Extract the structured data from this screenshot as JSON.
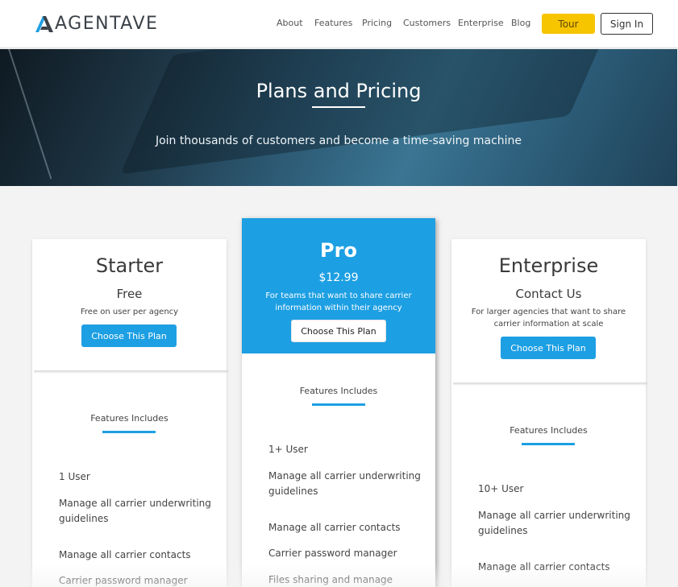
{
  "header": {
    "logo_text": "AGENTAVE",
    "nav": [
      "About",
      "Features",
      "Pricing",
      "Customers",
      "Enterprise",
      "Blog"
    ],
    "tour_label": "Tour",
    "signin_label": "Sign In"
  },
  "hero": {
    "title": "Plans and Pricing",
    "subtitle": "Join thousands of customers and become a time-saving machine"
  },
  "plans": [
    {
      "name": "Starter",
      "price": "Free",
      "description": "Free on user per agency",
      "button": "Choose This Plan",
      "features_heading": "Features Includes",
      "features": [
        "1 User",
        "Manage all carrier underwriting guidelines",
        "Manage all carrier contacts",
        "Carrier password manager"
      ]
    },
    {
      "name": "Pro",
      "price": "$12.99",
      "description": "For teams that want to share carrier information within their agency",
      "button": "Choose This Plan",
      "features_heading": "Features Includes",
      "features": [
        "1+ User",
        "Manage all carrier underwriting guidelines",
        "Manage all carrier contacts",
        "Carrier password manager",
        "Files sharing and manage carrier"
      ]
    },
    {
      "name": "Enterprise",
      "price": "Contact Us",
      "description": "For larger agencies that want to share carrier information at scale",
      "button": "Choose This Plan",
      "features_heading": "Features Includes",
      "features": [
        "10+ User",
        "Manage all carrier underwriting guidelines",
        "Manage all carrier contacts"
      ]
    }
  ],
  "colors": {
    "accent": "#1d9fe3",
    "tour": "#f7c400"
  }
}
